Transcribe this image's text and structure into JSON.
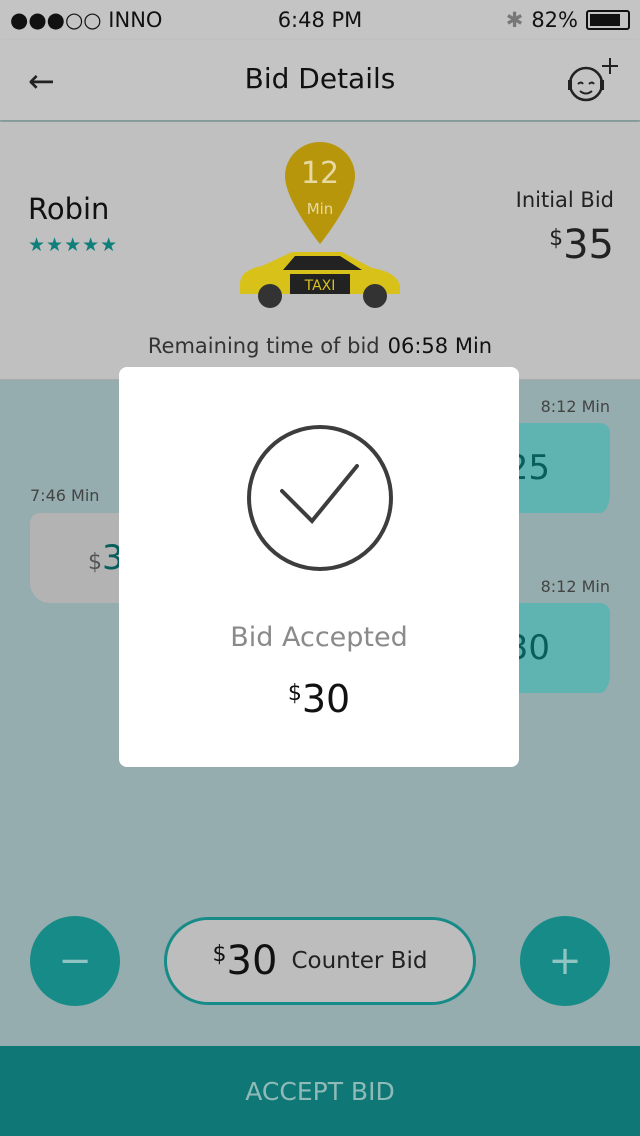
{
  "status_bar": {
    "carrier": "●●●○○ INNO",
    "time": "6:48 PM",
    "battery": "82%",
    "battery_level": 0.82
  },
  "header": {
    "title": "Bid Details",
    "back_icon": "arrow-left-icon",
    "support_icon": "support-agent-add-icon"
  },
  "hero": {
    "name": "Robin",
    "rating": 5,
    "stars": "★★★★★",
    "eta_value": "12",
    "eta_unit": "Min",
    "taxi_label": "TAXI",
    "initial_bid_label": "Initial Bid",
    "currency": "$",
    "initial_bid": "35",
    "remaining_label": "Remaining time of bid",
    "remaining_value": "06:58 Min"
  },
  "bids": [
    {
      "time": "8:12 Min",
      "amount": "25",
      "side": "right"
    },
    {
      "time": "7:46 Min",
      "currency": "$",
      "amount": "3",
      "side": "left"
    },
    {
      "time": "8:12 Min",
      "amount": "30",
      "side": "right"
    }
  ],
  "modal": {
    "icon": "check-circle-icon",
    "title": "Bid Accepted",
    "currency": "$",
    "amount": "30"
  },
  "counter": {
    "minus": "−",
    "plus": "+",
    "currency": "$",
    "amount": "30",
    "label": "Counter Bid"
  },
  "accept_button": "ACCEPT BID",
  "colors": {
    "accent": "#168b87",
    "pin": "#b8960c",
    "taxi": "#e8d21a"
  }
}
